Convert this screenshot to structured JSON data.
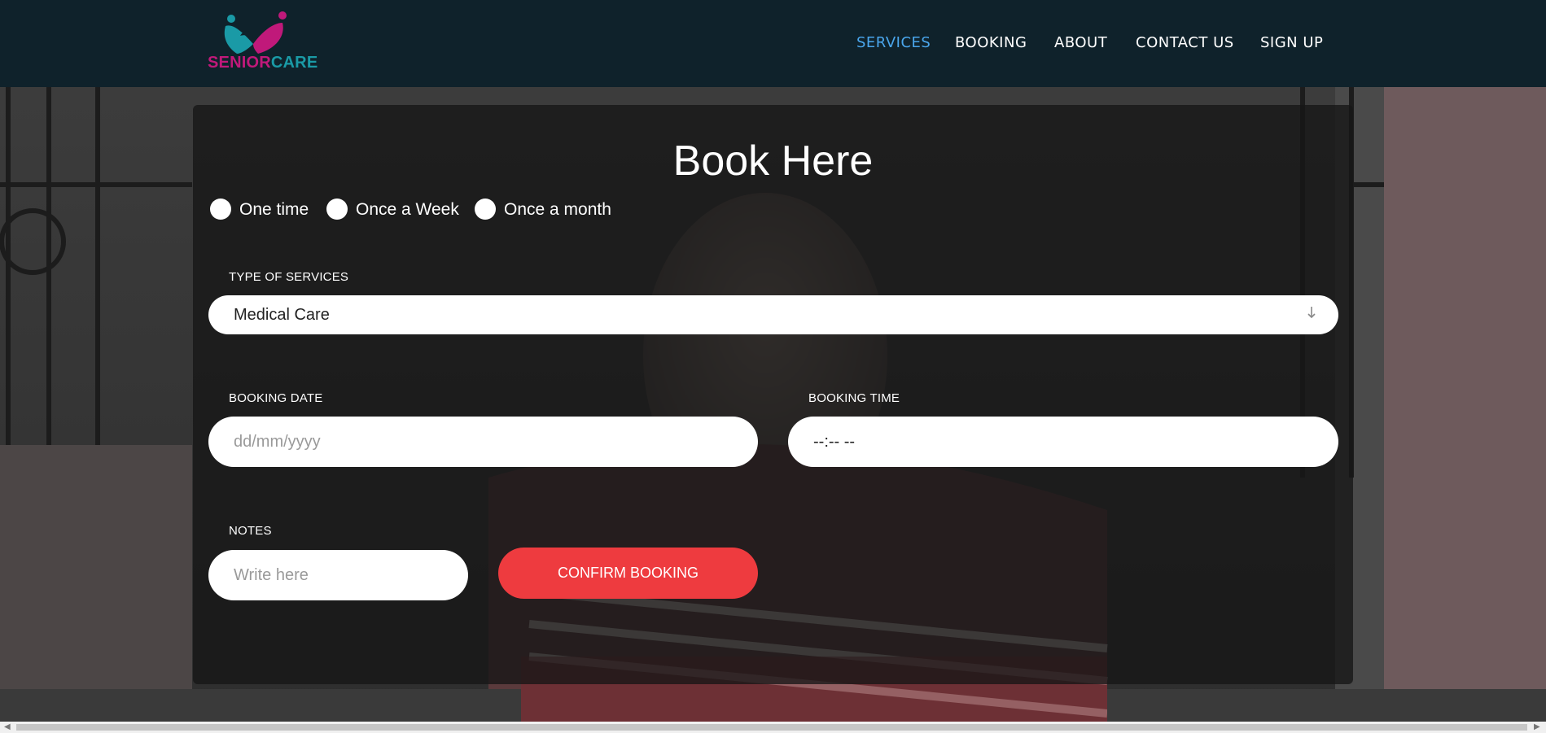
{
  "brand": {
    "name_part1": "SENIOR",
    "name_part2": "CARE"
  },
  "nav": {
    "items": [
      {
        "label": "SERVICES",
        "active": true
      },
      {
        "label": "BOOKING",
        "active": false
      },
      {
        "label": "ABOUT",
        "active": false
      },
      {
        "label": "CONTACT US",
        "active": false
      },
      {
        "label": "SIGN UP",
        "active": false
      }
    ]
  },
  "booking": {
    "title": "Book Here",
    "frequency_options": [
      "One time",
      "Once a Week",
      "Once a month"
    ],
    "service_type": {
      "label": "TYPE OF SERVICES",
      "value": "Medical Care"
    },
    "date": {
      "label": "BOOKING DATE",
      "placeholder": "dd/mm/yyyy"
    },
    "time": {
      "label": "BOOKING TIME",
      "placeholder": "--:-- --"
    },
    "notes": {
      "label": "NOTES",
      "placeholder": "Write here"
    },
    "confirm_label": "CONFIRM BOOKING"
  },
  "colors": {
    "header_bg": "#0f222b",
    "nav_active": "#4aa6ec",
    "confirm_button": "#ee3b3f",
    "brand_magenta": "#c0197a",
    "brand_teal": "#1a9aa6"
  },
  "icons": {
    "logo": "heart-people-logo-icon",
    "select_arrow": "arrow-down-icon",
    "scroll_left": "scroll-left-arrow-icon",
    "scroll_right": "scroll-right-arrow-icon"
  }
}
